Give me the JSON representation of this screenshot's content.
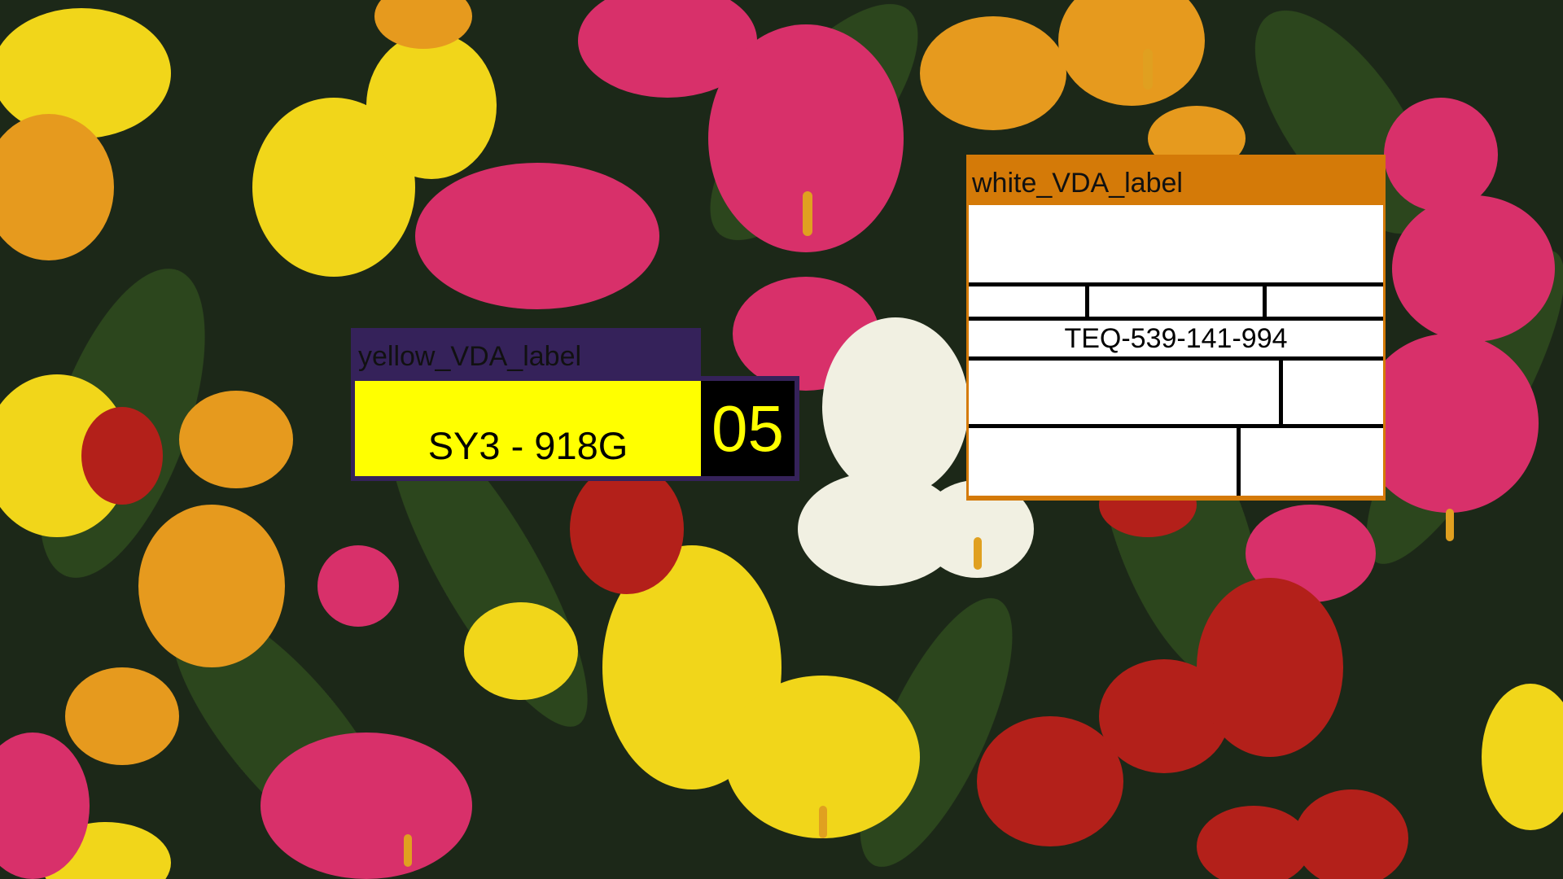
{
  "scene": {
    "description_icon": "calla-lily-flowers-photo"
  },
  "yellow_label": {
    "title": "yellow_VDA_label",
    "part_code": "SY3 - 918G",
    "number": "05",
    "colors": {
      "title_bar": "#35225a",
      "field": "#ffff00",
      "number_box": "#000000",
      "number_text": "#ffff00"
    }
  },
  "white_label": {
    "title": "white_VDA_label",
    "id_text": "TEQ-539-141-994",
    "colors": {
      "title_bar": "#d47a08",
      "field": "#ffffff",
      "lines": "#000000"
    }
  }
}
